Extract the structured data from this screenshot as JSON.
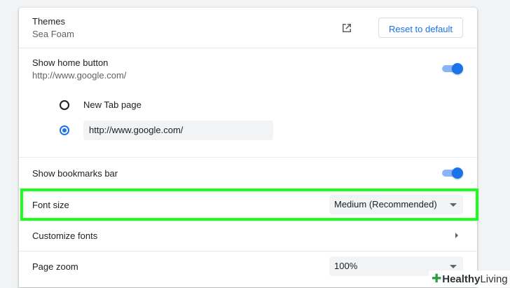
{
  "themes": {
    "label": "Themes",
    "value": "Sea Foam",
    "reset_label": "Reset to default"
  },
  "home_button": {
    "label": "Show home button",
    "url": "http://www.google.com/",
    "enabled": true,
    "options": [
      {
        "label": "New Tab page",
        "selected": false
      },
      {
        "label": "http://www.google.com/",
        "selected": true
      }
    ]
  },
  "bookmarks_bar": {
    "label": "Show bookmarks bar",
    "enabled": true
  },
  "font_size": {
    "label": "Font size",
    "selected": "Medium (Recommended)"
  },
  "customize_fonts": {
    "label": "Customize fonts"
  },
  "page_zoom": {
    "label": "Page zoom",
    "selected": "100%"
  },
  "colors": {
    "accent": "#1a73e8",
    "highlight": "#1cff1c"
  },
  "watermark": {
    "brand_a": "Healthy",
    "brand_b": "Living"
  }
}
